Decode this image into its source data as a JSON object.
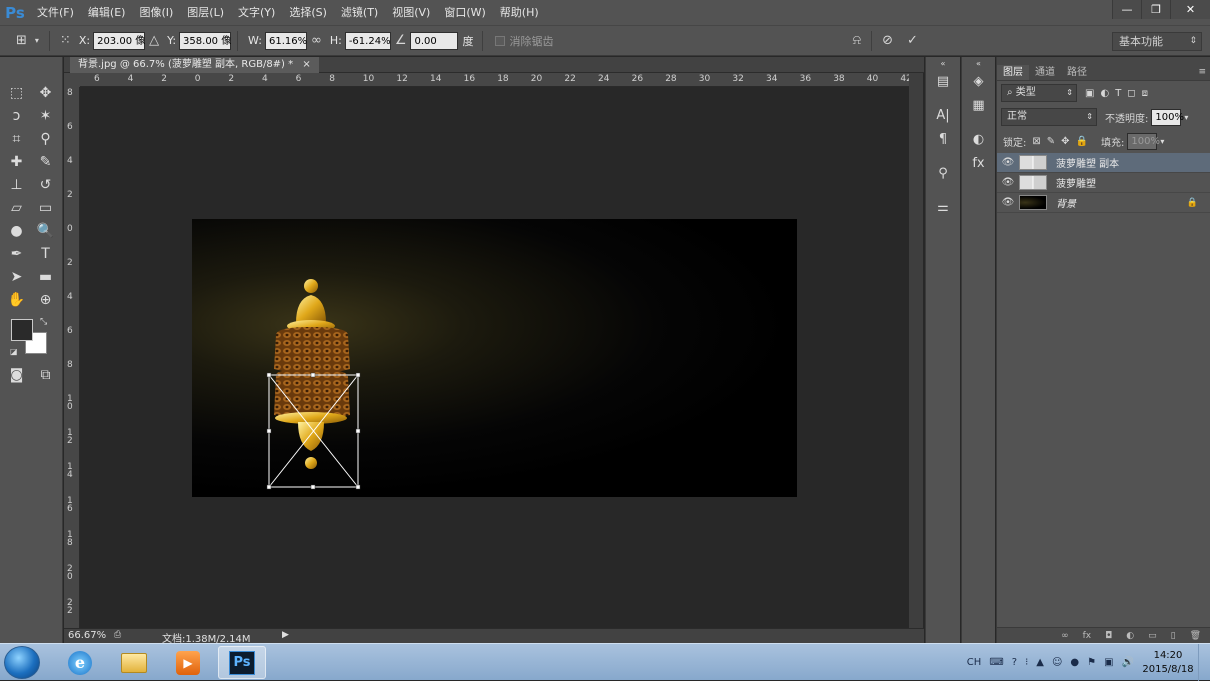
{
  "app": {
    "logo": "Ps"
  },
  "menu": [
    "文件(F)",
    "编辑(E)",
    "图像(I)",
    "图层(L)",
    "文字(Y)",
    "选择(S)",
    "滤镜(T)",
    "视图(V)",
    "窗口(W)",
    "帮助(H)"
  ],
  "window_controls": {
    "minimize": "—",
    "restore": "❐",
    "close": "✕"
  },
  "options": {
    "x_label": "X:",
    "x_value": "203.00 像",
    "y_label": "Y:",
    "y_value": "358.00 像",
    "w_label": "W:",
    "w_value": "61.16%",
    "h_label": "H:",
    "h_value": "-61.24%",
    "angle_value": "0.00",
    "angle_unit": "度",
    "antialias_label": "消除锯齿",
    "workspace": "基本功能"
  },
  "document": {
    "tab_title": "背景.jpg @ 66.7% (菠萝雕塑 副本, RGB/8#) *",
    "tab_close": "×",
    "zoom": "66.67%",
    "doc_size": "文档:1.38M/2.14M",
    "ruler_h": [
      "6",
      "4",
      "2",
      "0",
      "2",
      "4",
      "6",
      "8",
      "10",
      "12",
      "14",
      "16",
      "18",
      "20",
      "22",
      "24",
      "26",
      "28",
      "30",
      "32",
      "34",
      "36",
      "38",
      "40",
      "42"
    ],
    "ruler_v": [
      "8",
      "6",
      "4",
      "2",
      "0",
      "2",
      "4",
      "6",
      "8",
      "10",
      "12",
      "14",
      "16",
      "18",
      "20",
      "22"
    ]
  },
  "layers_panel": {
    "tabs": [
      "图层",
      "通道",
      "路径"
    ],
    "filter_kind": "类型",
    "blend_mode": "正常",
    "opacity_label": "不透明度:",
    "opacity_value": "100%",
    "lock_label": "锁定:",
    "fill_label": "填充:",
    "fill_value": "100%",
    "layers": [
      {
        "name": "菠萝雕塑 副本",
        "selected": true
      },
      {
        "name": "菠萝雕塑",
        "selected": false
      },
      {
        "name": "背景",
        "selected": false,
        "locked": true
      }
    ]
  },
  "taskbar": {
    "apps": [
      "internet-explorer",
      "file-explorer",
      "media-player",
      "photoshop"
    ],
    "ps_label": "Ps",
    "ime": "CH",
    "time": "14:20",
    "date": "2015/8/18"
  }
}
